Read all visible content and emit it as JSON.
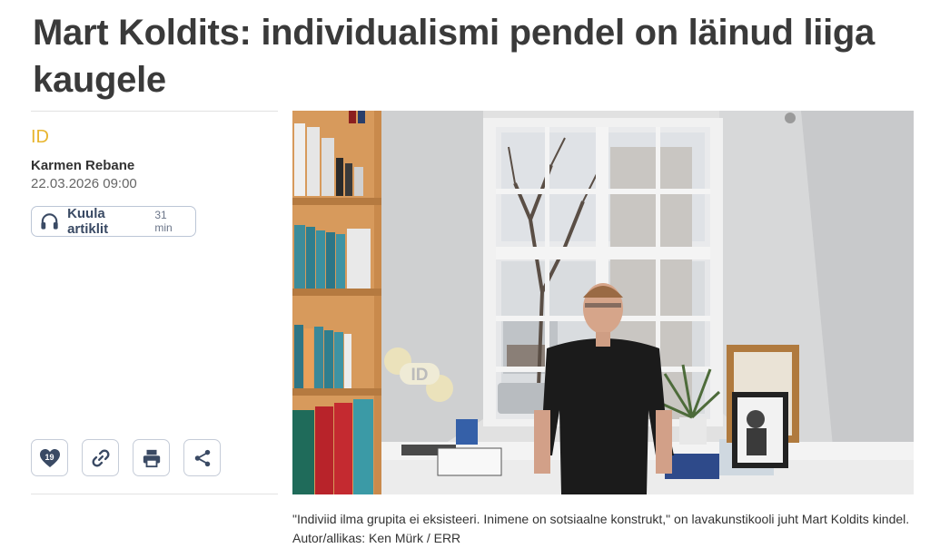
{
  "article": {
    "title": "Mart Koldits: individualismi pendel on läinud liiga kaugele",
    "section": "ID",
    "author": "Karmen Rebane",
    "date": "22.03.2026 09:00"
  },
  "listen": {
    "label": "Kuula artiklit",
    "duration": "31 min",
    "icon": "headphones-icon"
  },
  "actions": {
    "like_count": "19",
    "icons": [
      "heart-icon",
      "link-icon",
      "print-icon",
      "share-icon"
    ]
  },
  "photo": {
    "watermark": "ID",
    "caption": "\"Indiviid ilma grupita ei eksisteeri. Inimene on sotsiaalne konstrukt,\" on lavakunstikooli juht Mart Koldits kindel. Autor/allikas: Ken Mürk / ERR"
  },
  "colors": {
    "accent": "#e8b52e",
    "button_text": "#3a4a64",
    "button_border": "#bcc6d6"
  }
}
